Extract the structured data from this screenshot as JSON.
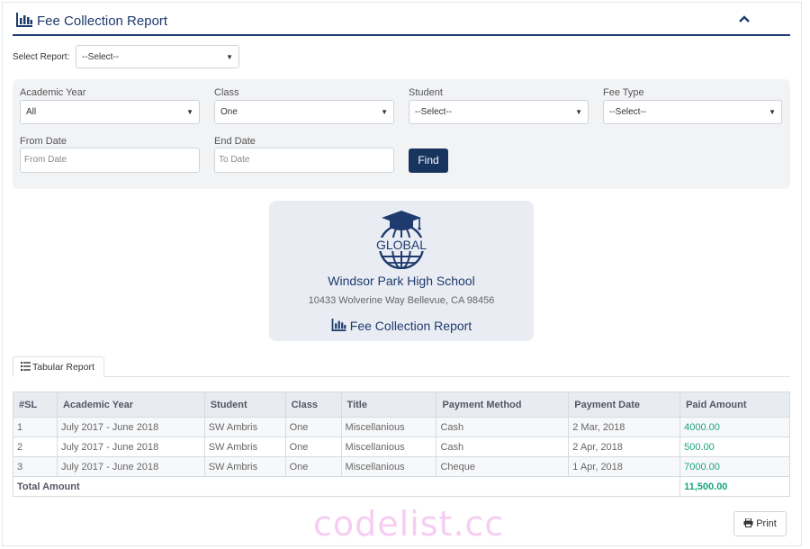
{
  "header": {
    "title": "Fee Collection Report",
    "icon": "bar-chart-icon",
    "collapse_icon": "chevron-up-icon"
  },
  "select_report": {
    "label": "Select Report:",
    "value": "--Select--"
  },
  "filters": {
    "academic_year": {
      "label": "Academic Year",
      "value": "All"
    },
    "class": {
      "label": "Class",
      "value": "One"
    },
    "student": {
      "label": "Student",
      "value": "--Select--"
    },
    "fee_type": {
      "label": "Fee Type",
      "value": "--Select--"
    },
    "from_date": {
      "label": "From Date",
      "placeholder": "From Date"
    },
    "end_date": {
      "label": "End Date",
      "placeholder": "To Date"
    },
    "find_label": "Find"
  },
  "school": {
    "logo_text": "GLOBAL",
    "name": "Windsor Park High School",
    "address": "10433 Wolverine Way Bellevue, CA 98456",
    "report_title": "Fee Collection Report"
  },
  "tabs": [
    {
      "label": "Tabular Report",
      "icon": "list-icon"
    }
  ],
  "table": {
    "columns": [
      "#SL",
      "Academic Year",
      "Student",
      "Class",
      "Title",
      "Payment Method",
      "Payment Date",
      "Paid Amount"
    ],
    "rows": [
      [
        "1",
        "July 2017 - June 2018",
        "SW Ambris",
        "One",
        "Miscellanious",
        "Cash",
        "2 Mar, 2018",
        "4000.00"
      ],
      [
        "2",
        "July 2017 - June 2018",
        "SW Ambris",
        "One",
        "Miscellanious",
        "Cash",
        "2 Apr, 2018",
        "500.00"
      ],
      [
        "3",
        "July 2017 - June 2018",
        "SW Ambris",
        "One",
        "Miscellanious",
        "Cheque",
        "1 Apr, 2018",
        "7000.00"
      ]
    ],
    "total_label": "Total Amount",
    "total_value": "11,500.00"
  },
  "watermark": "codelist.cc",
  "print_label": "Print",
  "colors": {
    "primary": "#1e3a6e",
    "button": "#17345f",
    "amount": "#1aa47f",
    "panel": "#f2f3f5",
    "watermark": "#f7cdf2"
  }
}
